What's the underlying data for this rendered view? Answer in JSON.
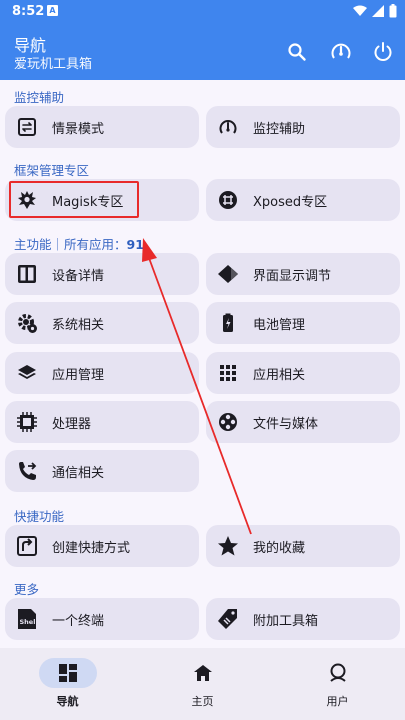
{
  "status_bar": {
    "time": "8:52",
    "notification_badge": "A"
  },
  "app_bar": {
    "title": "导航",
    "subtitle": "爱玩机工具箱",
    "actions": [
      "search-icon",
      "speedometer-icon",
      "power-icon"
    ]
  },
  "sections": {
    "monitor": {
      "title": "监控辅助"
    },
    "framework": {
      "title": "框架管理专区"
    },
    "main": {
      "title_prefix": "主功能｜所有应用：",
      "count": "91"
    },
    "shortcut": {
      "title": "快捷功能"
    },
    "more": {
      "title": "更多"
    }
  },
  "cards": {
    "scene_mode": "情景模式",
    "monitor_assist": "监控辅助",
    "magisk": "Magisk专区",
    "xposed": "Xposed专区",
    "device_info": "设备详情",
    "display_tune": "界面显示调节",
    "system": "系统相关",
    "battery": "电池管理",
    "app_manage": "应用管理",
    "app_related": "应用相关",
    "processor": "处理器",
    "files_media": "文件与媒体",
    "communication": "通信相关",
    "create_shortcut": "创建快捷方式",
    "favorites": "我的收藏",
    "terminal": "一个终端",
    "extra_tools": "附加工具箱"
  },
  "bottom_nav": {
    "items": [
      {
        "label": "导航",
        "icon": "dashboard-icon",
        "active": true
      },
      {
        "label": "主页",
        "icon": "home-icon",
        "active": false
      },
      {
        "label": "用户",
        "icon": "user-icon",
        "active": false
      }
    ]
  },
  "colors": {
    "primary": "#3f85ee",
    "annotation": "#e82a2a",
    "card": "#e6e3f2"
  }
}
